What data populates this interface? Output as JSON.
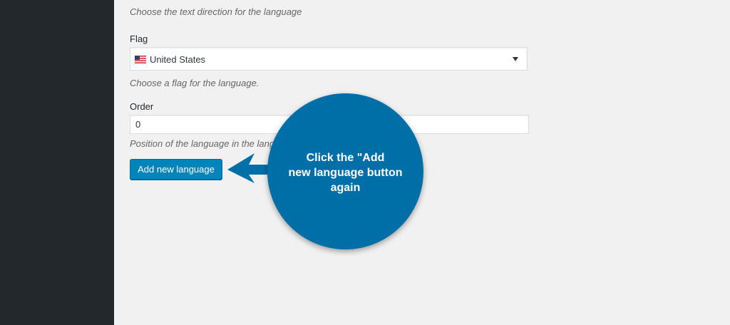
{
  "form": {
    "text_direction_desc": "Choose the text direction for the language",
    "flag": {
      "label": "Flag",
      "selected": "United States",
      "flag_icon": "us-flag-icon",
      "desc": "Choose a flag for the language."
    },
    "order": {
      "label": "Order",
      "value": "0",
      "desc": "Position of the language in the langu"
    },
    "submit_label": "Add new language"
  },
  "callout": {
    "line1": "Click the \"Add",
    "line2": "new language button",
    "line3": "again"
  },
  "colors": {
    "sidebar": "#23282d",
    "background": "#f1f1f1",
    "button": "#0085ba",
    "callout": "#006fa8"
  }
}
